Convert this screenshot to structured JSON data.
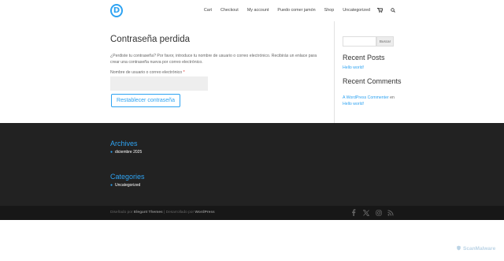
{
  "header": {
    "logo_letter": "D",
    "nav": [
      "Cart",
      "Checkout",
      "My account",
      "Puedo comer jamón",
      "Shop",
      "Uncategorized"
    ]
  },
  "main": {
    "title": "Contraseña perdida",
    "description": "¿Perdiste tu contraseña? Por favor, introduce tu nombre de usuario o correo electrónico. Recibirás un enlace para crear una contraseña nueva por correo electrónico.",
    "field_label": "Nombre de usuario o correo electrónico",
    "required_mark": "*",
    "field_value": "",
    "button_label": "Restablecer contraseña"
  },
  "sidebar": {
    "search_placeholder": "",
    "search_button": "Buscar",
    "recent_posts_title": "Recent Posts",
    "recent_posts": [
      "Hello world!"
    ],
    "recent_comments_title": "Recent Comments",
    "comment_author": "A WordPress Commenter",
    "comment_on": "en",
    "comment_post": "Hello world!"
  },
  "footer": {
    "archives_title": "Archives",
    "archives": [
      "diciembre 2025"
    ],
    "categories_title": "Categories",
    "categories": [
      "Uncategorized"
    ],
    "credits_prefix": "Diseñado por",
    "credits_theme": "Elegant Themes",
    "credits_mid": "| Desarrollado por",
    "credits_platform": "WordPress",
    "social_icons": [
      "facebook-icon",
      "x-twitter-icon",
      "instagram-icon",
      "rss-icon"
    ]
  },
  "watermark": "ScanMalware",
  "colors": {
    "accent": "#2ea3f2",
    "footer_bg": "#222222",
    "footer_bottom_bg": "#171717",
    "required": "#e02b27"
  }
}
